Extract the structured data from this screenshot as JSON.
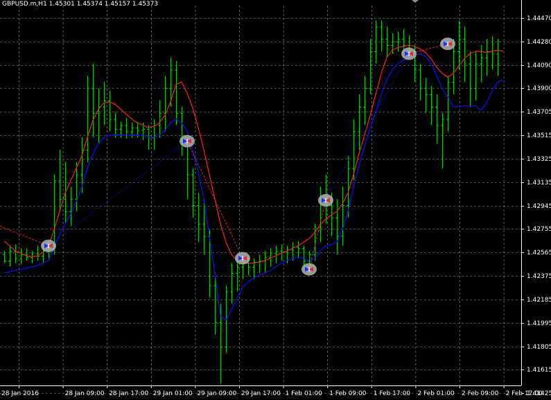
{
  "window": {
    "title": "GBPUSD.m,H1  1.45301 1.45374 1.45157 1.45373",
    "symbol": "GBPUSD.m",
    "timeframe": "H1",
    "ohlc": [
      "1.45301",
      "1.45374",
      "1.45157",
      "1.45373"
    ]
  },
  "colors": {
    "background": "#000000",
    "grid": "#c0c0c0",
    "bars": "#00d000",
    "ma_fast": "#ff2020",
    "ma_slow": "#1010ff",
    "trade_line": "#ff2020",
    "text": "#ffffff"
  },
  "chart_data": {
    "type": "line",
    "price_axis_labels": [
      "1.44470",
      "1.44280",
      "1.44090",
      "1.43900",
      "1.43705",
      "1.43515",
      "1.43325",
      "1.43135",
      "1.42945",
      "1.42755",
      "1.42565",
      "1.42375",
      "1.42185",
      "1.41995",
      "1.41805",
      "1.41615",
      "1.41425"
    ],
    "time_axis_labels": [
      "28 Jan 2016",
      "28 Jan 09:00",
      "28 Jan 17:00",
      "29 Jan 01:00",
      "29 Jan 09:00",
      "29 Jan 17:00",
      "1 Feb 01:00",
      "1 Feb 09:00",
      "1 Feb 17:00",
      "2 Feb 01:00",
      "2 Feb 09:00",
      "2 Feb 17:00"
    ],
    "ylim": [
      1.4141,
      1.4459
    ],
    "bars": [
      [
        1.4255,
        1.4258,
        1.4248,
        1.425
      ],
      [
        1.425,
        1.4262,
        1.4245,
        1.4258
      ],
      [
        1.4258,
        1.4263,
        1.4248,
        1.4252
      ],
      [
        1.4252,
        1.426,
        1.4247,
        1.4255
      ],
      [
        1.4255,
        1.426,
        1.425,
        1.4253
      ],
      [
        1.4253,
        1.4258,
        1.4248,
        1.4256
      ],
      [
        1.4256,
        1.4262,
        1.425,
        1.4254
      ],
      [
        1.4254,
        1.4262,
        1.4248,
        1.4258
      ],
      [
        1.4258,
        1.4265,
        1.4252,
        1.426
      ],
      [
        1.426,
        1.432,
        1.4255,
        1.4315
      ],
      [
        1.4315,
        1.434,
        1.429,
        1.43
      ],
      [
        1.43,
        1.433,
        1.428,
        1.429
      ],
      [
        1.429,
        1.431,
        1.4278,
        1.43
      ],
      [
        1.43,
        1.433,
        1.429,
        1.432
      ],
      [
        1.432,
        1.435,
        1.4305,
        1.434
      ],
      [
        1.434,
        1.44,
        1.433,
        1.439
      ],
      [
        1.439,
        1.441,
        1.435,
        1.437
      ],
      [
        1.437,
        1.439,
        1.4345,
        1.4375
      ],
      [
        1.4375,
        1.4395,
        1.436,
        1.438
      ],
      [
        1.438,
        1.4388,
        1.4355,
        1.4365
      ],
      [
        1.4365,
        1.437,
        1.435,
        1.4357
      ],
      [
        1.4357,
        1.4363,
        1.435,
        1.436
      ],
      [
        1.436,
        1.4366,
        1.4349,
        1.4355
      ],
      [
        1.4355,
        1.4362,
        1.435,
        1.4358
      ],
      [
        1.4358,
        1.4363,
        1.435,
        1.4356
      ],
      [
        1.4356,
        1.4362,
        1.4348,
        1.4357
      ],
      [
        1.4357,
        1.436,
        1.434,
        1.435
      ],
      [
        1.435,
        1.4365,
        1.434,
        1.436
      ],
      [
        1.436,
        1.438,
        1.435,
        1.437
      ],
      [
        1.437,
        1.44,
        1.4355,
        1.439
      ],
      [
        1.439,
        1.4415,
        1.4375,
        1.4405
      ],
      [
        1.4405,
        1.4412,
        1.436,
        1.437
      ],
      [
        1.437,
        1.4375,
        1.4335,
        1.4345
      ],
      [
        1.4345,
        1.435,
        1.43,
        1.432
      ],
      [
        1.432,
        1.4325,
        1.4285,
        1.4295
      ],
      [
        1.4295,
        1.4305,
        1.4265,
        1.428
      ],
      [
        1.428,
        1.43,
        1.4255,
        1.427
      ],
      [
        1.427,
        1.4275,
        1.422,
        1.423
      ],
      [
        1.423,
        1.424,
        1.419,
        1.42
      ],
      [
        1.42,
        1.4215,
        1.415,
        1.418
      ],
      [
        1.418,
        1.423,
        1.4175,
        1.4225
      ],
      [
        1.4225,
        1.4248,
        1.4215,
        1.424
      ],
      [
        1.424,
        1.425,
        1.4225,
        1.4245
      ],
      [
        1.4245,
        1.4252,
        1.4235,
        1.4248
      ],
      [
        1.4248,
        1.4253,
        1.4238,
        1.4245
      ],
      [
        1.4245,
        1.4252,
        1.4235,
        1.4249
      ],
      [
        1.4249,
        1.4255,
        1.424,
        1.425
      ],
      [
        1.425,
        1.4258,
        1.424,
        1.4253
      ],
      [
        1.4253,
        1.426,
        1.4245,
        1.4256
      ],
      [
        1.4256,
        1.4262,
        1.4248,
        1.4258
      ],
      [
        1.4258,
        1.4263,
        1.425,
        1.4257
      ],
      [
        1.4257,
        1.4262,
        1.4248,
        1.4259
      ],
      [
        1.4259,
        1.4265,
        1.425,
        1.4261
      ],
      [
        1.4261,
        1.4266,
        1.4252,
        1.426
      ],
      [
        1.426,
        1.4262,
        1.4245,
        1.425
      ],
      [
        1.425,
        1.4258,
        1.424,
        1.4255
      ],
      [
        1.4255,
        1.428,
        1.425,
        1.4275
      ],
      [
        1.4275,
        1.431,
        1.4265,
        1.43
      ],
      [
        1.43,
        1.432,
        1.428,
        1.4295
      ],
      [
        1.4295,
        1.4305,
        1.427,
        1.4285
      ],
      [
        1.4285,
        1.43,
        1.4255,
        1.427
      ],
      [
        1.427,
        1.431,
        1.4262,
        1.4295
      ],
      [
        1.4295,
        1.4335,
        1.4285,
        1.4325
      ],
      [
        1.4325,
        1.4365,
        1.4315,
        1.4355
      ],
      [
        1.4355,
        1.4385,
        1.434,
        1.4375
      ],
      [
        1.4375,
        1.44,
        1.436,
        1.439
      ],
      [
        1.439,
        1.443,
        1.4385,
        1.442
      ],
      [
        1.442,
        1.4445,
        1.441,
        1.444
      ],
      [
        1.444,
        1.4445,
        1.442,
        1.443
      ],
      [
        1.443,
        1.444,
        1.4415,
        1.4425
      ],
      [
        1.4425,
        1.4435,
        1.4418,
        1.4428
      ],
      [
        1.4428,
        1.4436,
        1.442,
        1.443
      ],
      [
        1.443,
        1.4438,
        1.442,
        1.4425
      ],
      [
        1.4425,
        1.4433,
        1.4415,
        1.442
      ],
      [
        1.442,
        1.4425,
        1.4395,
        1.4405
      ],
      [
        1.4405,
        1.441,
        1.438,
        1.439
      ],
      [
        1.439,
        1.4398,
        1.437,
        1.4385
      ],
      [
        1.4385,
        1.4392,
        1.436,
        1.4375
      ],
      [
        1.4375,
        1.4385,
        1.4345,
        1.436
      ],
      [
        1.436,
        1.437,
        1.4325,
        1.4365
      ],
      [
        1.4365,
        1.44,
        1.4355,
        1.4395
      ],
      [
        1.4395,
        1.443,
        1.4385,
        1.442
      ],
      [
        1.442,
        1.4445,
        1.4405,
        1.443
      ],
      [
        1.443,
        1.444,
        1.4395,
        1.441
      ],
      [
        1.441,
        1.442,
        1.4375,
        1.439
      ],
      [
        1.439,
        1.442,
        1.438,
        1.441
      ],
      [
        1.441,
        1.4425,
        1.4395,
        1.4415
      ],
      [
        1.4415,
        1.443,
        1.44,
        1.442
      ],
      [
        1.442,
        1.4432,
        1.4405,
        1.4418
      ],
      [
        1.4418,
        1.443,
        1.44,
        1.441
      ]
    ],
    "series": [
      {
        "key": "ma_fast",
        "values": [
          1.4266,
          1.4262,
          1.4258,
          1.4256,
          1.4254,
          1.4253,
          1.4254,
          1.4257,
          1.4262,
          1.4275,
          1.429,
          1.4305,
          1.4315,
          1.4325,
          1.4335,
          1.435,
          1.4364,
          1.4373,
          1.4378,
          1.4379,
          1.4377,
          1.4373,
          1.4369,
          1.4365,
          1.4362,
          1.436,
          1.4358,
          1.4359,
          1.4362,
          1.4368,
          1.4379,
          1.4393,
          1.4395,
          1.4386,
          1.4374,
          1.4358,
          1.434,
          1.432,
          1.43,
          1.428,
          1.4265,
          1.4255,
          1.425,
          1.4249,
          1.4248,
          1.4248,
          1.4249,
          1.425,
          1.4252,
          1.4254,
          1.4256,
          1.4258,
          1.426,
          1.4262,
          1.4265,
          1.4268,
          1.4273,
          1.4279,
          1.4284,
          1.4287,
          1.429,
          1.4296,
          1.4305,
          1.432,
          1.4337,
          1.4352,
          1.4368,
          1.4385,
          1.4402,
          1.4415,
          1.4421,
          1.4423,
          1.4424,
          1.4425,
          1.4424,
          1.4422,
          1.4419,
          1.4414,
          1.4407,
          1.4402,
          1.4399,
          1.4402,
          1.4408,
          1.4414,
          1.4418,
          1.442,
          1.442,
          1.4419,
          1.442,
          1.4421,
          1.442
        ]
      },
      {
        "key": "ma_slow",
        "values": [
          1.424,
          1.4241,
          1.4242,
          1.4243,
          1.4244,
          1.4245,
          1.4246,
          1.4248,
          1.425,
          1.426,
          1.4272,
          1.428,
          1.4288,
          1.4298,
          1.431,
          1.4325,
          1.4337,
          1.4345,
          1.435,
          1.4352,
          1.4352,
          1.4352,
          1.4352,
          1.4352,
          1.4352,
          1.4352,
          1.435,
          1.435,
          1.4352,
          1.4356,
          1.4362,
          1.4365,
          1.4362,
          1.4355,
          1.434,
          1.4322,
          1.43,
          1.427,
          1.424,
          1.4205,
          1.4202,
          1.421,
          1.422,
          1.4228,
          1.4233,
          1.4236,
          1.4238,
          1.424,
          1.4242,
          1.4245,
          1.4248,
          1.425,
          1.4252,
          1.4253,
          1.4252,
          1.425,
          1.4252,
          1.4258,
          1.4262,
          1.4263,
          1.4265,
          1.4275,
          1.429,
          1.431,
          1.4327,
          1.4343,
          1.4358,
          1.437,
          1.4385,
          1.4397,
          1.4405,
          1.441,
          1.4413,
          1.4415,
          1.4417,
          1.4418,
          1.4416,
          1.441,
          1.44,
          1.439,
          1.4383,
          1.4375,
          1.4375,
          1.4376,
          1.4375,
          1.4376,
          1.4372,
          1.4378,
          1.4388,
          1.4395,
          1.4397
        ]
      }
    ],
    "trade_markers": [
      {
        "i": 8,
        "price": 1.4262
      },
      {
        "i": 33,
        "price": 1.4347
      },
      {
        "i": 43,
        "price": 1.4252
      },
      {
        "i": 55,
        "price": 1.4243
      },
      {
        "i": 58,
        "price": 1.4299
      },
      {
        "i": 73,
        "price": 1.4418
      },
      {
        "i": 80,
        "price": 1.4426
      }
    ],
    "trade_lines": [
      {
        "from": "left-edge",
        "to": 0,
        "style": "dashed",
        "color_key": "trade_line",
        "start_price": 1.4278
      },
      {
        "from": 1,
        "to": 2,
        "style": "dashed",
        "color_key": "trade_line"
      },
      {
        "from": 3,
        "to": 4,
        "style": "dashed",
        "color_key": "trade_line"
      },
      {
        "from": 5,
        "to": 6,
        "style": "dashed",
        "color_key": "trade_line"
      },
      {
        "from": 0,
        "to": 1,
        "style": "dotted",
        "color_key": "ma_slow"
      },
      {
        "from": 4,
        "to": 5,
        "style": "dotted",
        "color_key": "ma_slow"
      }
    ],
    "grid": true
  }
}
